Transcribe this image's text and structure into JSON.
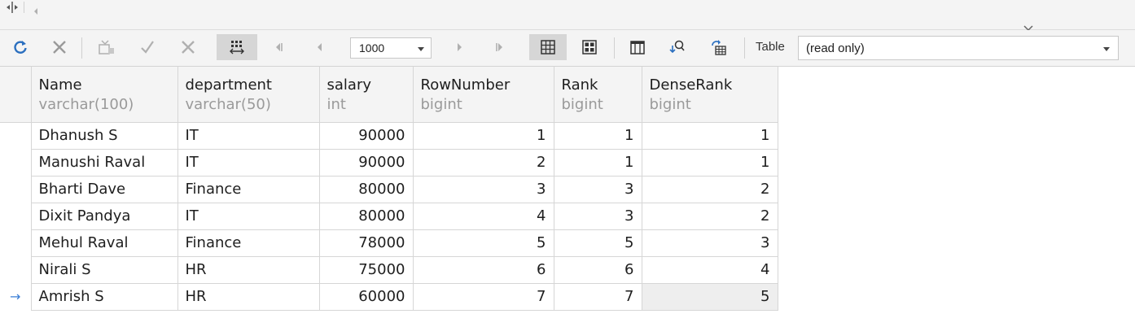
{
  "toolbar": {
    "icons": [
      "refresh-icon",
      "cancel-icon",
      "apply-icon",
      "confirm-icon",
      "discard-icon",
      "grid-layout-icon",
      "first-page-icon",
      "prev-page-icon",
      "next-page-icon",
      "last-page-icon",
      "grid-view-icon",
      "card-view-icon",
      "columns-icon",
      "find-icon",
      "export-icon"
    ],
    "page_size": "1000",
    "table_label": "Table",
    "table_value": "(read only)"
  },
  "grid": {
    "columns": [
      {
        "name": "Name",
        "type": "varchar(100)"
      },
      {
        "name": "department",
        "type": "varchar(50)"
      },
      {
        "name": "salary",
        "type": "int"
      },
      {
        "name": "RowNumber",
        "type": "bigint"
      },
      {
        "name": "Rank",
        "type": "bigint"
      },
      {
        "name": "DenseRank",
        "type": "bigint"
      }
    ],
    "rows": [
      [
        "Dhanush S",
        "IT",
        "90000",
        "1",
        "1",
        "1"
      ],
      [
        "Manushi Raval",
        "IT",
        "90000",
        "2",
        "1",
        "1"
      ],
      [
        "Bharti Dave",
        "Finance",
        "80000",
        "3",
        "3",
        "2"
      ],
      [
        "Dixit Pandya",
        "IT",
        "80000",
        "4",
        "3",
        "2"
      ],
      [
        "Mehul Raval",
        "Finance",
        "78000",
        "5",
        "5",
        "3"
      ],
      [
        "Nirali S",
        "HR",
        "75000",
        "6",
        "6",
        "4"
      ],
      [
        "Amrish S",
        "HR",
        "60000",
        "7",
        "7",
        "5"
      ]
    ],
    "current_row_marker": "→"
  }
}
